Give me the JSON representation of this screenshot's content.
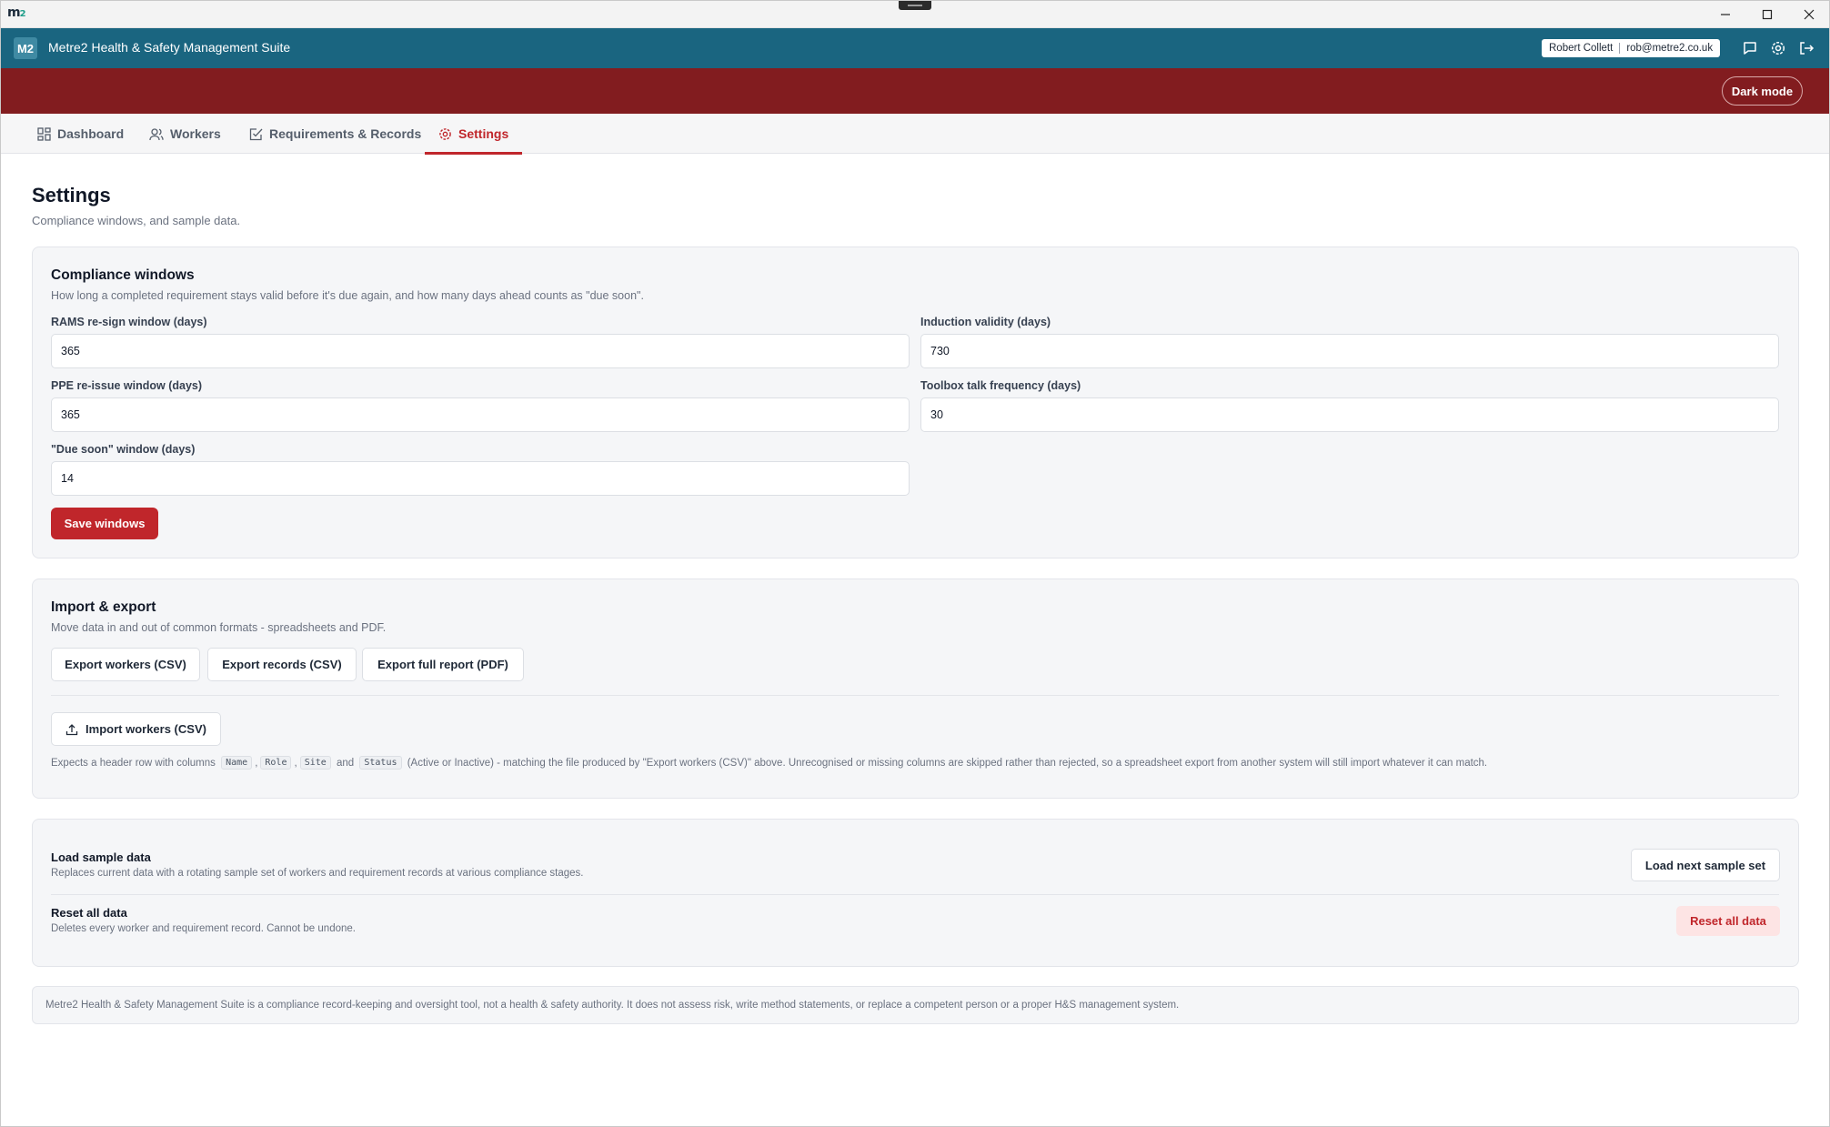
{
  "window": {
    "app_glyph": "m",
    "app_glyph_sub": "2",
    "controls": [
      {
        "icon": "minimize-icon"
      },
      {
        "icon": "maximize-icon"
      },
      {
        "icon": "close-icon"
      }
    ]
  },
  "header": {
    "logo": "M2",
    "title": "Metre2 Health & Safety Management Suite",
    "user_name": "Robert Collett",
    "user_email": "rob@metre2.co.uk",
    "icons": [
      "feedback-icon",
      "settings-gear-icon",
      "logout-icon"
    ],
    "color": "#1a6580"
  },
  "banner": {
    "dark_mode_label": "Dark mode",
    "color": "#821c1f"
  },
  "tabs": [
    {
      "label": "Dashboard",
      "icon": "dashboard-icon",
      "active": false
    },
    {
      "label": "Workers",
      "icon": "users-icon",
      "active": false
    },
    {
      "label": "Requirements & Records",
      "icon": "checklist-icon",
      "active": false
    },
    {
      "label": "Settings",
      "icon": "gear-icon",
      "active": true
    }
  ],
  "page": {
    "title": "Settings",
    "subtitle": "Compliance windows, and sample data."
  },
  "compliance": {
    "title": "Compliance windows",
    "description": "How long a completed requirement stays valid before it's due again, and how many days ahead counts as \"due soon\".",
    "fields": {
      "rams_label": "RAMS re-sign window (days)",
      "rams_value": "365",
      "induction_label": "Induction validity (days)",
      "induction_value": "730",
      "ppe_label": "PPE re-issue window (days)",
      "ppe_value": "365",
      "toolbox_label": "Toolbox talk frequency (days)",
      "toolbox_value": "30",
      "due_soon_label": "\"Due soon\" window (days)",
      "due_soon_value": "14"
    },
    "save_label": "Save windows"
  },
  "import_export": {
    "title": "Import & export",
    "description": "Move data in and out of common formats - spreadsheets and PDF.",
    "export_workers_label": "Export workers (CSV)",
    "export_records_label": "Export records (CSV)",
    "export_report_label": "Export full report (PDF)",
    "import_workers_label": "Import workers (CSV)",
    "help_prefix": "Expects a header row with columns",
    "col_name": "Name",
    "col_role": "Role",
    "col_site": "Site",
    "col_status": "Status",
    "comma": ",",
    "and": "and",
    "help_suffix": "(Active or Inactive) - matching the file produced by \"Export workers (CSV)\" above. Unrecognised or missing columns are skipped rather than rejected, so a spreadsheet export from another system will still import whatever it can match."
  },
  "data_mgmt": {
    "sample_title": "Load sample data",
    "sample_desc": "Replaces current data with a rotating sample set of workers and requirement records at various compliance stages.",
    "sample_button": "Load next sample set",
    "reset_title": "Reset all data",
    "reset_desc": "Deletes every worker and requirement record. Cannot be undone.",
    "reset_button": "Reset all data"
  },
  "disclaimer": "Metre2 Health & Safety Management Suite is a compliance record-keeping and oversight tool, not a health & safety authority. It does not assess risk, write method statements, or replace a competent person or a proper H&S management system.",
  "colors": {
    "accent": "#c0262b",
    "header": "#1a6580",
    "banner": "#821c1f"
  }
}
